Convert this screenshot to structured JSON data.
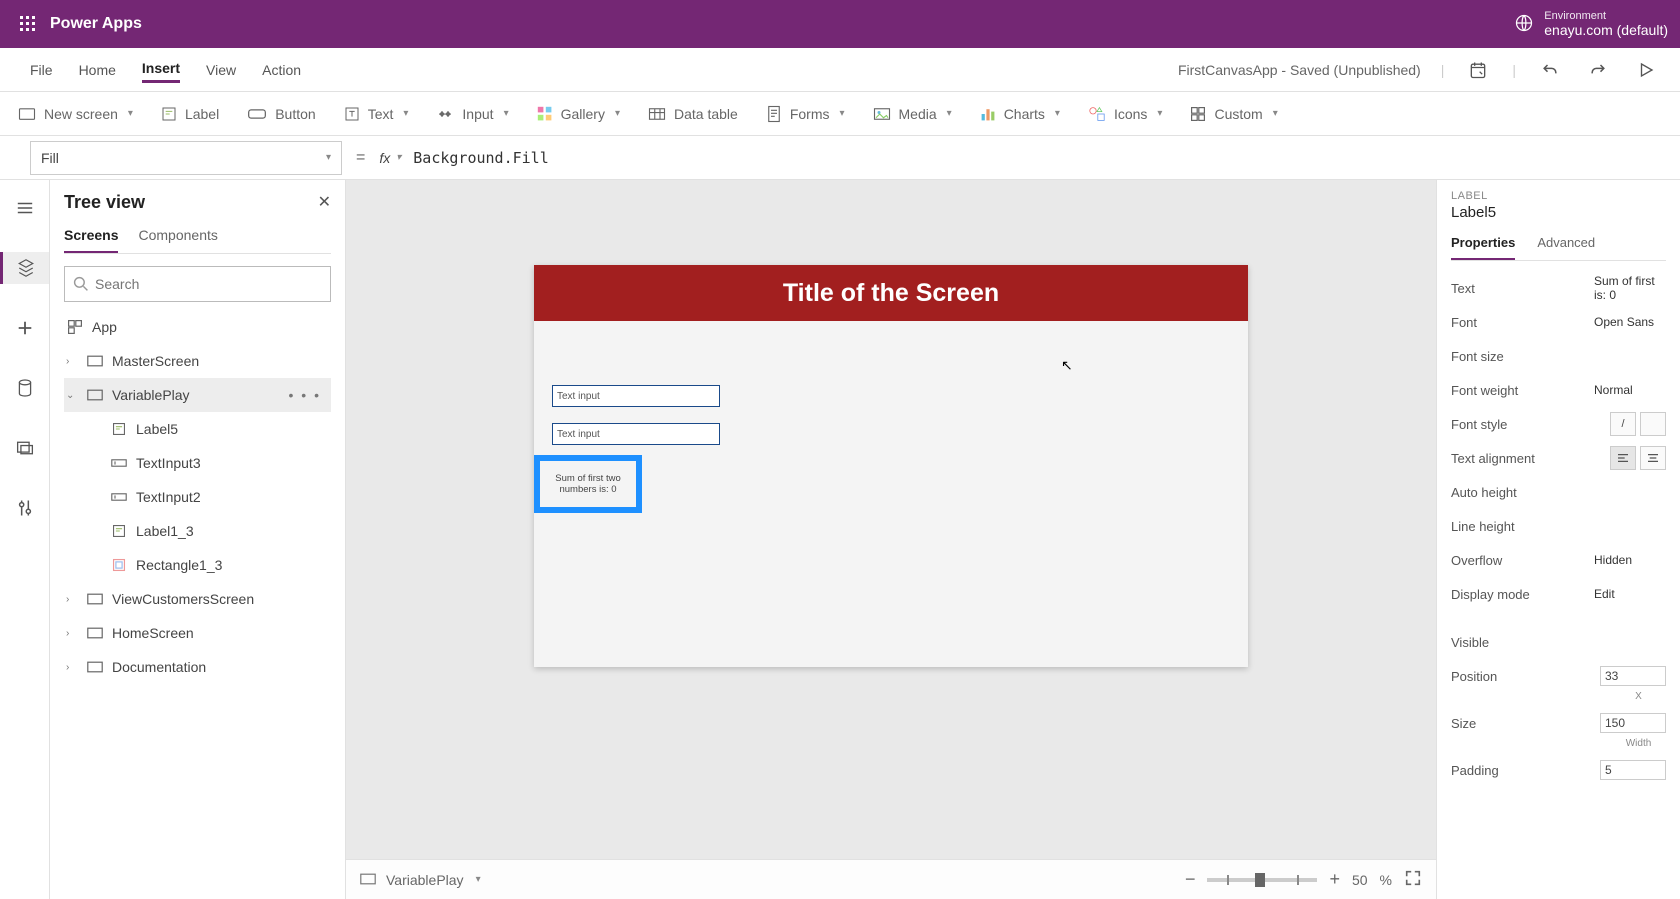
{
  "titlebar": {
    "app": "Power Apps",
    "env_label": "Environment",
    "env_value": "enayu.com (default)"
  },
  "menus": {
    "file": "File",
    "home": "Home",
    "insert": "Insert",
    "view": "View",
    "action": "Action",
    "doc_status": "FirstCanvasApp - Saved (Unpublished)"
  },
  "ribbon": {
    "newscreen": "New screen",
    "label": "Label",
    "button": "Button",
    "text": "Text",
    "input": "Input",
    "gallery": "Gallery",
    "datatable": "Data table",
    "forms": "Forms",
    "media": "Media",
    "charts": "Charts",
    "icons": "Icons",
    "custom": "Custom"
  },
  "formula": {
    "property": "Fill",
    "value": "Background.Fill",
    "fx": "fx"
  },
  "tree": {
    "title": "Tree view",
    "tabs": {
      "screens": "Screens",
      "components": "Components"
    },
    "search_placeholder": "Search",
    "app": "App",
    "nodes": [
      {
        "label": "MasterScreen"
      },
      {
        "label": "VariablePlay",
        "selected": true,
        "expanded": true,
        "children": [
          {
            "label": "Label5",
            "icon": "label"
          },
          {
            "label": "TextInput3",
            "icon": "textinput"
          },
          {
            "label": "TextInput2",
            "icon": "textinput"
          },
          {
            "label": "Label1_3",
            "icon": "label"
          },
          {
            "label": "Rectangle1_3",
            "icon": "rect"
          }
        ]
      },
      {
        "label": "ViewCustomersScreen"
      },
      {
        "label": "HomeScreen"
      },
      {
        "label": "Documentation"
      }
    ]
  },
  "canvas": {
    "banner": "Title of the Screen",
    "input_placeholder": "Text input",
    "sum_label": "Sum of first two numbers is: 0"
  },
  "statusbar": {
    "screen": "VariablePlay",
    "zoom": "50",
    "unit": "%"
  },
  "props": {
    "type": "LABEL",
    "name": "Label5",
    "tabs": {
      "properties": "Properties",
      "advanced": "Advanced"
    },
    "rows": {
      "text_label": "Text",
      "text_value": "Sum of first is: 0",
      "font_label": "Font",
      "font_value": "Open Sans",
      "fontsize_label": "Font size",
      "fontweight_label": "Font weight",
      "fontweight_value": "Normal",
      "fontstyle_label": "Font style",
      "fontstyle_value": "/",
      "textalign_label": "Text alignment",
      "autoheight_label": "Auto height",
      "lineheight_label": "Line height",
      "overflow_label": "Overflow",
      "overflow_value": "Hidden",
      "displaymode_label": "Display mode",
      "displaymode_value": "Edit",
      "visible_label": "Visible",
      "position_label": "Position",
      "position_x": "33",
      "position_x_sub": "X",
      "size_label": "Size",
      "size_w": "150",
      "size_w_sub": "Width",
      "padding_label": "Padding",
      "padding_v": "5"
    }
  }
}
